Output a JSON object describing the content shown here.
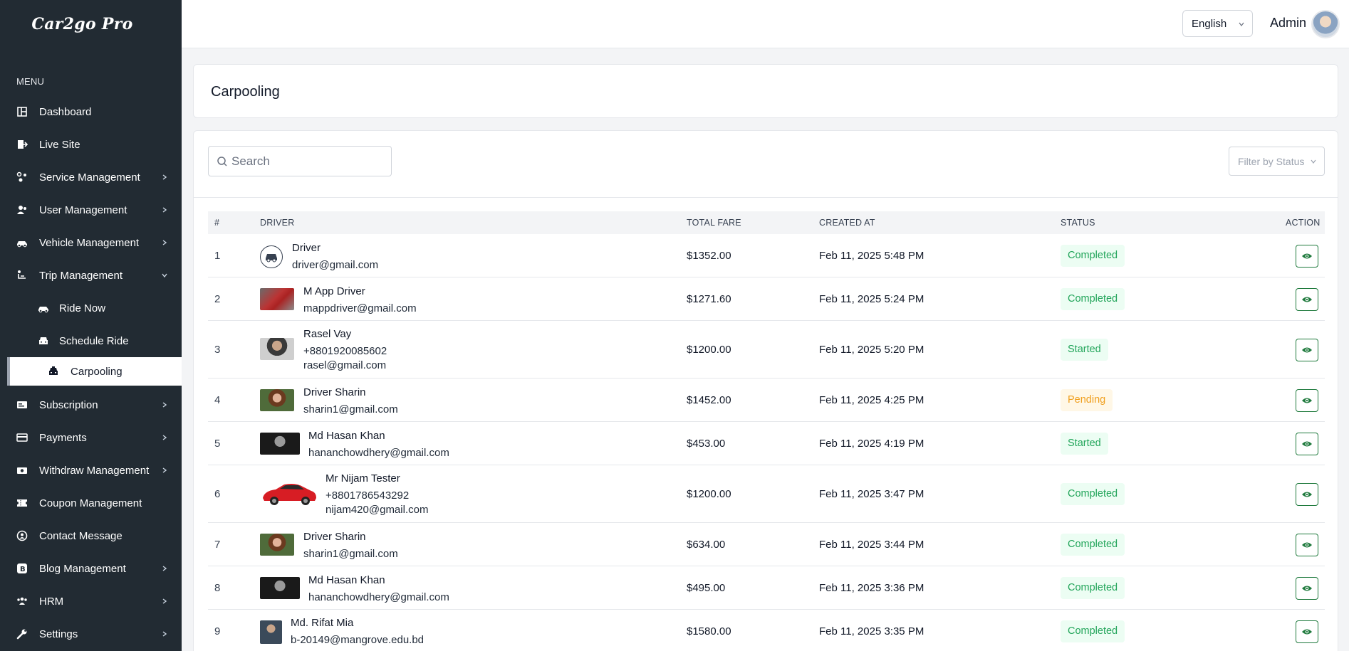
{
  "app": {
    "logo": "Car2go Pro"
  },
  "sidebar": {
    "menu_title": "MENU",
    "items": [
      {
        "label": "Dashboard",
        "icon": "dashboard-icon"
      },
      {
        "label": "Live Site",
        "icon": "live-site-icon"
      },
      {
        "label": "Service Management",
        "icon": "service-icon"
      },
      {
        "label": "User Management",
        "icon": "users-icon"
      },
      {
        "label": "Vehicle Management",
        "icon": "car-icon"
      },
      {
        "label": "Trip Management",
        "icon": "trip-icon"
      },
      {
        "label": "Ride Now",
        "icon": "car-icon"
      },
      {
        "label": "Schedule Ride",
        "icon": "car-front-icon"
      },
      {
        "label": "Carpooling",
        "icon": "taxi-icon"
      },
      {
        "label": "Subscription",
        "icon": "subscription-icon"
      },
      {
        "label": "Payments",
        "icon": "credit-card-icon"
      },
      {
        "label": "Withdraw Management",
        "icon": "money-icon"
      },
      {
        "label": "Coupon Management",
        "icon": "coupon-icon"
      },
      {
        "label": "Contact Message",
        "icon": "contact-icon"
      },
      {
        "label": "Blog Management",
        "icon": "blog-icon"
      },
      {
        "label": "HRM",
        "icon": "people-icon"
      },
      {
        "label": "Settings",
        "icon": "wrench-icon"
      }
    ]
  },
  "header": {
    "language": "English",
    "user_name": "Admin"
  },
  "page": {
    "title": "Carpooling",
    "search_placeholder": "Search",
    "filter_placeholder": "Filter by Status"
  },
  "table": {
    "columns": [
      "#",
      "DRIVER",
      "TOTAL FARE",
      "CREATED AT",
      "STATUS",
      "ACTION"
    ],
    "rows": [
      {
        "num": "1",
        "name": "Driver",
        "phone": "",
        "email": "driver@gmail.com",
        "fare": "$1352.00",
        "created": "Feb 11, 2025 5:48 PM",
        "status": "Completed"
      },
      {
        "num": "2",
        "name": "M App Driver",
        "phone": "",
        "email": "mappdriver@gmail.com",
        "fare": "$1271.60",
        "created": "Feb 11, 2025 5:24 PM",
        "status": "Completed"
      },
      {
        "num": "3",
        "name": "Rasel Vay",
        "phone": "+8801920085602",
        "email": "rasel@gmail.com",
        "fare": "$1200.00",
        "created": "Feb 11, 2025 5:20 PM",
        "status": "Started"
      },
      {
        "num": "4",
        "name": "Driver Sharin",
        "phone": "",
        "email": "sharin1@gmail.com",
        "fare": "$1452.00",
        "created": "Feb 11, 2025 4:25 PM",
        "status": "Pending"
      },
      {
        "num": "5",
        "name": "Md Hasan Khan",
        "phone": "",
        "email": "hananchowdhery@gmail.com",
        "fare": "$453.00",
        "created": "Feb 11, 2025 4:19 PM",
        "status": "Started"
      },
      {
        "num": "6",
        "name": "Mr Nijam Tester",
        "phone": "+8801786543292",
        "email": "nijam420@gmail.com",
        "fare": "$1200.00",
        "created": "Feb 11, 2025 3:47 PM",
        "status": "Completed"
      },
      {
        "num": "7",
        "name": "Driver Sharin",
        "phone": "",
        "email": "sharin1@gmail.com",
        "fare": "$634.00",
        "created": "Feb 11, 2025 3:44 PM",
        "status": "Completed"
      },
      {
        "num": "8",
        "name": "Md Hasan Khan",
        "phone": "",
        "email": "hananchowdhery@gmail.com",
        "fare": "$495.00",
        "created": "Feb 11, 2025 3:36 PM",
        "status": "Completed"
      },
      {
        "num": "9",
        "name": "Md. Rifat Mia",
        "phone": "",
        "email": "b-20149@mangrove.edu.bd",
        "fare": "$1580.00",
        "created": "Feb 11, 2025 3:35 PM",
        "status": "Completed"
      }
    ]
  },
  "colors": {
    "sidebar_bg": "#222b33",
    "completed": "#22a55a",
    "pending": "#f0a020",
    "action_border": "#1f7a3d"
  }
}
